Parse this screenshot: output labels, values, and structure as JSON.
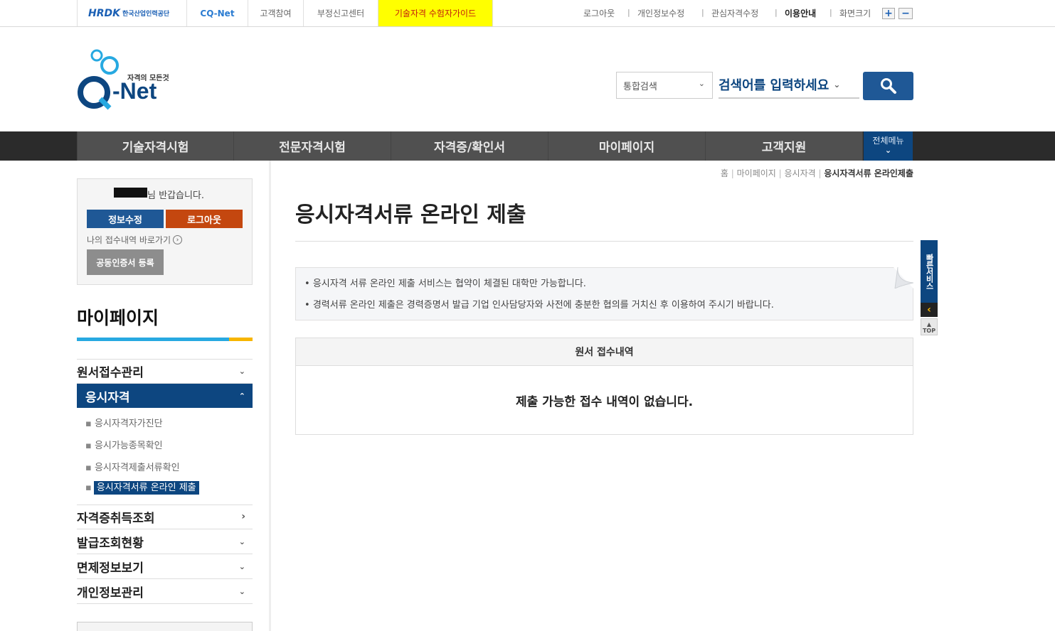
{
  "topbar": {
    "hrdk_logo": "HRDK",
    "hrdk_sub": "한국산업인력공단",
    "cqnet_logo": "CQ-Net",
    "links": [
      "고객참여",
      "부정신고센터"
    ],
    "guide": "기술자격 수험자가이드",
    "util": [
      "로그아웃",
      "개인정보수정",
      "관심자격수정",
      "이용안내",
      "화면크기"
    ],
    "zoom_in": "+",
    "zoom_out": "−"
  },
  "header": {
    "logo_tagline": "자격의 모든것",
    "logo_text": "-Net",
    "search_scope": "통합검색",
    "search_placeholder": "검색어를 입력하세요"
  },
  "gnb": {
    "items": [
      "기술자격시험",
      "전문자격시험",
      "자격증/확인서",
      "마이페이지",
      "고객지원"
    ],
    "all_menu": "전체메뉴"
  },
  "user_box": {
    "greeting": "님 반갑습니다.",
    "edit_btn": "정보수정",
    "logout_btn": "로그아웃",
    "shortcut": "나의 접수내역 바로가기",
    "cert_btn": "공동인증서 등록"
  },
  "sidebar": {
    "title": "마이페이지",
    "menu": [
      {
        "label": "원서접수관리",
        "icon": "chevron-down"
      },
      {
        "label": "응시자격",
        "icon": "chevron-up",
        "active": true,
        "children": [
          "응시자격자가진단",
          "응시가능종목확인",
          "응시자격제출서류확인",
          "응시자격서류 온라인 제출"
        ]
      },
      {
        "label": "자격증취득조회",
        "icon": "chevron-right"
      },
      {
        "label": "발급조회현황",
        "icon": "chevron-down"
      },
      {
        "label": "면제정보보기",
        "icon": "chevron-down"
      },
      {
        "label": "개인정보관리",
        "icon": "chevron-down"
      }
    ]
  },
  "breadcrumb": [
    "홈",
    "마이페이지",
    "응시자격",
    "응시자격서류 온라인제출"
  ],
  "main": {
    "title": "응시자격서류 온라인 제출",
    "notices": [
      "응시자격 서류 온라인 제출 서비스는 협약이 체결된 대학만 가능합니다.",
      "경력서류 온라인 제출은 경력증명서 발급 기업 인사담당자와 사전에 충분한 협의를 거치신 후 이용하여 주시기 바랍니다."
    ],
    "table_header": "원서 접수내역",
    "empty_msg": "제출 가능한 접수 내역이 없습니다."
  },
  "quick": {
    "label": "빠른서비스",
    "top": "TOP"
  },
  "colors": {
    "navy": "#0d4680",
    "orange": "#c4470f",
    "yellow": "#ffff00",
    "sky": "#27a9e1",
    "gold": "#f7b500"
  }
}
